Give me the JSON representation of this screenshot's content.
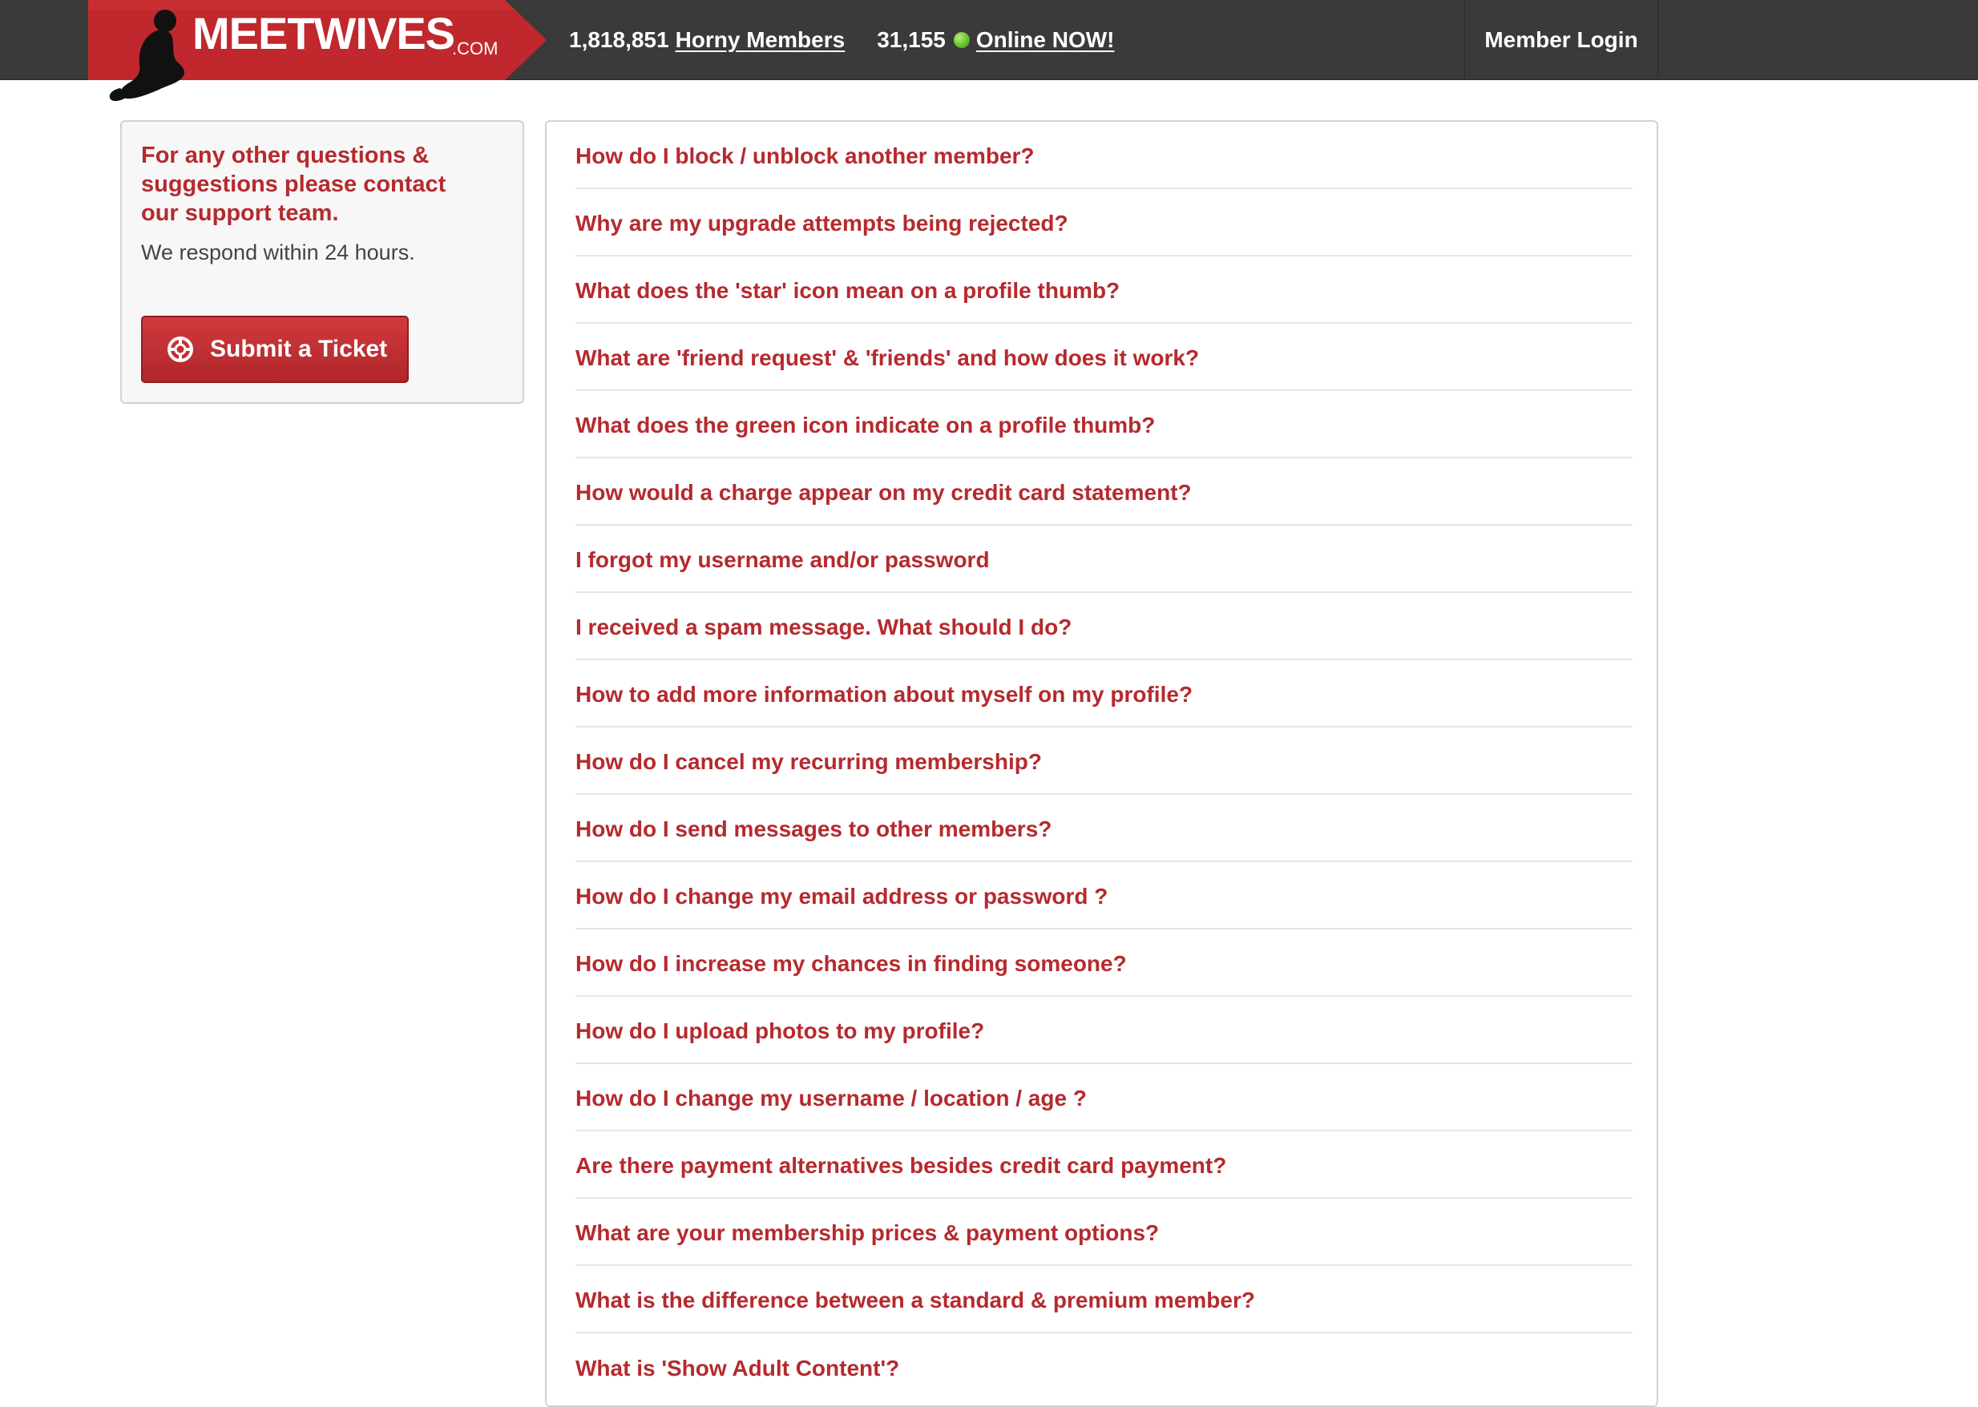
{
  "header": {
    "logo_text": "MEETWIVES",
    "logo_tld": ".COM",
    "member_count": "1,818,851",
    "members_link": "Horny Members",
    "online_count": "31,155",
    "online_link": "Online NOW!",
    "login_label": "Member Login"
  },
  "support": {
    "heading": "For any other questions & suggestions please contact our support team.",
    "response_text": "We respond within 24 hours.",
    "button_label": "Submit a Ticket"
  },
  "faq": {
    "questions": [
      "How do I block / unblock another member?",
      "Why are my upgrade attempts being rejected?",
      "What does the 'star' icon mean on a profile thumb?",
      "What are 'friend request' & 'friends' and how does it work?",
      "What does the green icon indicate on a profile thumb?",
      "How would a charge appear on my credit card statement?",
      "I forgot my username and/or password",
      "I received a spam message. What should I do?",
      "How to add more information about myself on my profile?",
      "How do I cancel my recurring membership?",
      "How do I send messages to other members?",
      "How do I change my email address or password ?",
      "How do I increase my chances in finding someone?",
      "How do I upload photos to my profile?",
      "How do I change my username / location / age ?",
      "Are there payment alternatives besides credit card payment?",
      "What are your membership prices & payment options?",
      "What is the difference between a standard & premium member?",
      "What is 'Show Adult Content'?"
    ]
  },
  "colors": {
    "topbar": "#3a3a3a",
    "brand_red": "#c0282d",
    "link_red": "#b52a2e",
    "online_green": "#68c12c"
  },
  "icons": {
    "logo_figure": "silhouette-logo-icon",
    "online_indicator": "online-dot-icon",
    "support": "lifebuoy-icon"
  }
}
